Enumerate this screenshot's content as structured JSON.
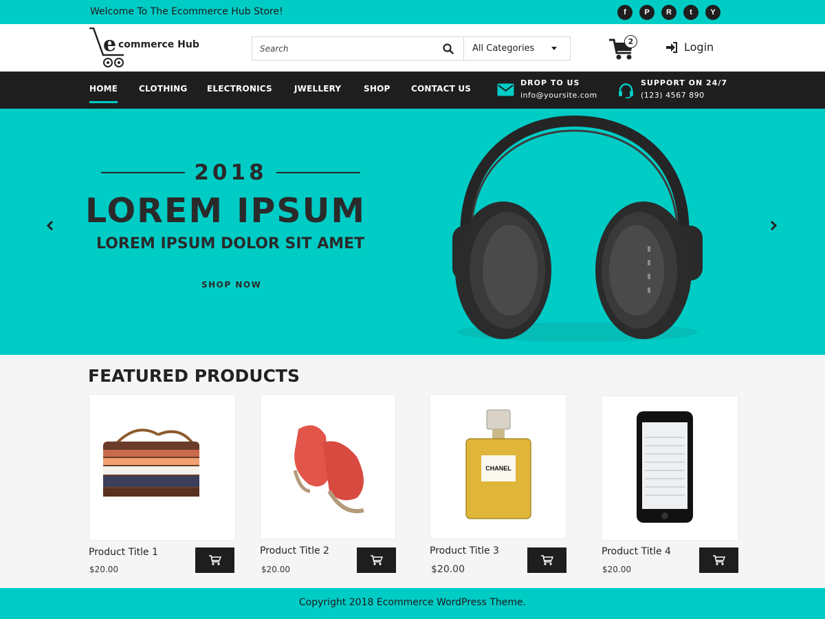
{
  "topbar": {
    "welcome": "Welcome To The Ecommerce Hub Store!",
    "socials": [
      {
        "icon": "facebook-icon",
        "glyph": "f"
      },
      {
        "icon": "pinterest-icon",
        "glyph": "P"
      },
      {
        "icon": "rss-icon",
        "glyph": "R"
      },
      {
        "icon": "twitter-icon",
        "glyph": "t"
      },
      {
        "icon": "youtube-icon",
        "glyph": "Y"
      }
    ]
  },
  "header": {
    "logo_text": "commerce Hub",
    "search_placeholder": "Search",
    "category": "All Categories",
    "cart_count": "2",
    "login": "Login"
  },
  "nav": {
    "items": [
      "HOME",
      "CLOTHING",
      "ELECTRONICS",
      "JWELLERY",
      "SHOP",
      "CONTACT US"
    ],
    "active": "HOME",
    "drop": {
      "title": "DROP TO US",
      "value": "info@yoursite.com"
    },
    "support": {
      "title": "SUPPORT ON 24/7",
      "value": "(123) 4567 890"
    }
  },
  "hero": {
    "year": "2018",
    "title": "LOREM IPSUM",
    "subtitle": "LOREM IPSUM DOLOR SIT AMET",
    "cta": "SHOP NOW"
  },
  "featured": {
    "title": "FEATURED PRODUCTS",
    "products": [
      {
        "title": "Product Title 1",
        "price": "$20.00",
        "image": "wallet"
      },
      {
        "title": "Product Title 2",
        "price": "$20.00",
        "image": "shoes"
      },
      {
        "title": "Product Title 3",
        "price": "$20.00",
        "image": "perfume",
        "image_label": "CHANEL"
      },
      {
        "title": "Product Title 4",
        "price": "$20.00",
        "image": "smartphone"
      }
    ]
  },
  "footer": {
    "copyright": "Copyright 2018 Ecommerce WordPress Theme."
  },
  "colors": {
    "accent": "#00ccc6",
    "dark": "#1e1e1e"
  }
}
